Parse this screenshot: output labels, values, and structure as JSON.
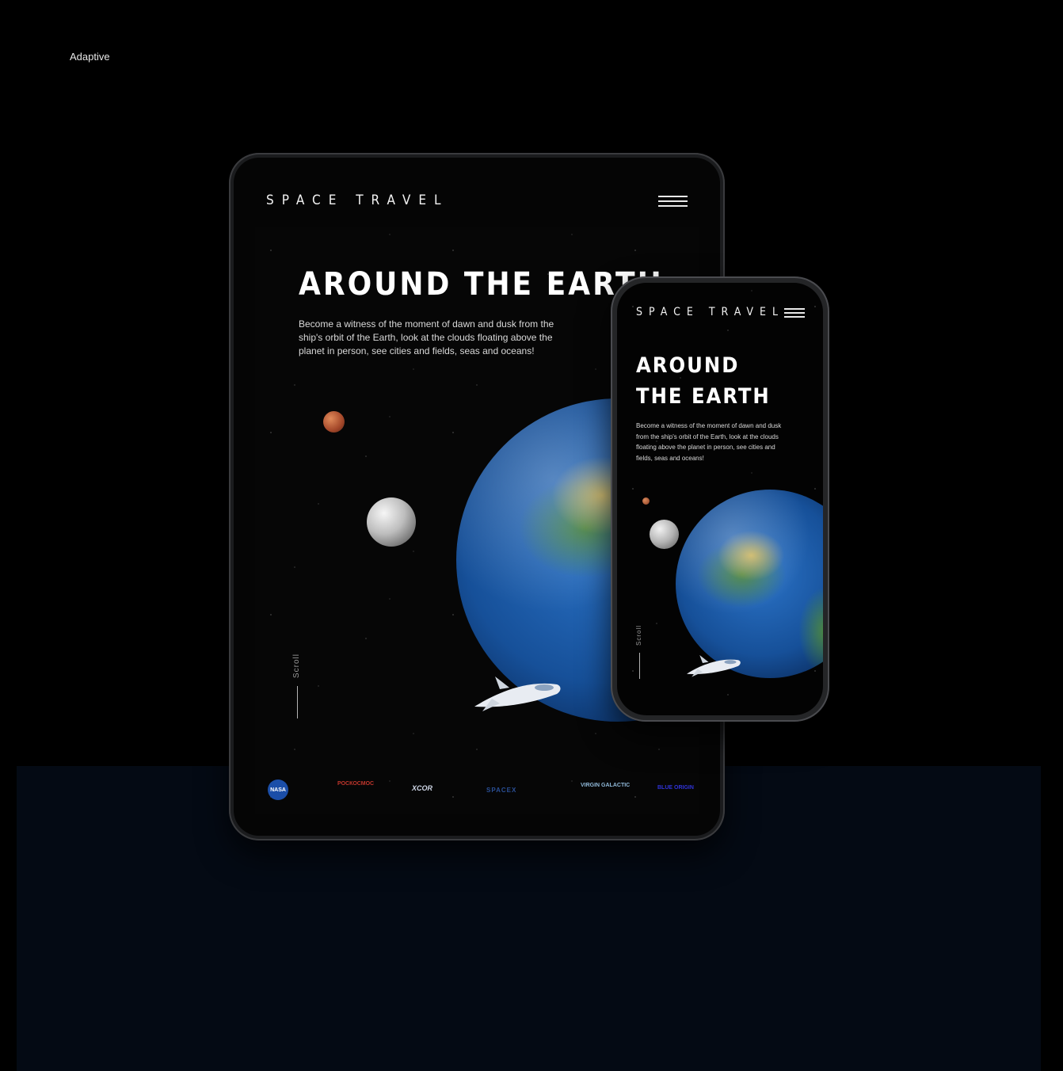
{
  "section": {
    "label": "Adaptive"
  },
  "brand": "SPACE TRAVEL",
  "hero": {
    "title_line1": "AROUND",
    "title_line2": "THE EARTH",
    "title_full": "AROUND THE EARTH",
    "text": "Become a witness of the moment of dawn and dusk from the ship's orbit of the Earth, look at the clouds floating above the planet in person, see cities and fields, seas and oceans!"
  },
  "scroll": {
    "label": "Scroll"
  },
  "partners": [
    {
      "name": "NASA"
    },
    {
      "name": "РОСКОСМОС"
    },
    {
      "name": "XCOR"
    },
    {
      "name": "SPACEX"
    },
    {
      "name": "VIRGIN GALACTIC"
    },
    {
      "name": "BLUE ORIGIN"
    }
  ],
  "icons": [
    "hamburger-menu-icon",
    "mars-icon",
    "moon-icon",
    "earth-icon",
    "spaceship-icon"
  ],
  "colors": {
    "background": "#000000",
    "bottom_band": "#040a14",
    "text": "#ffffff",
    "nasa_blue": "#1b4ea8",
    "blue_origin": "#2f33d8"
  }
}
